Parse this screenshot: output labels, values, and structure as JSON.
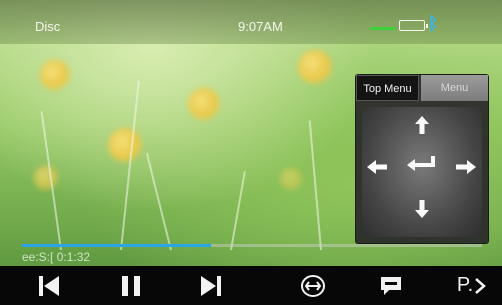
{
  "status_bar": {
    "source": "Disc",
    "time": "9:07AM",
    "icons": [
      "signal-icon",
      "battery-icon",
      "bluetooth-icon"
    ]
  },
  "menu_panel": {
    "tabs": [
      {
        "label": "Top Menu",
        "selected": true
      },
      {
        "label": "Menu",
        "selected": false
      }
    ],
    "dpad": [
      "arrow-up-icon",
      "arrow-left-icon",
      "enter-icon",
      "arrow-right-icon",
      "arrow-down-icon"
    ]
  },
  "playback": {
    "track_info": "ee:S:[ 0:1:32",
    "progress": 0.41
  },
  "controls": {
    "buttons": [
      {
        "name": "previous-track-button",
        "icon": "skip-previous-icon"
      },
      {
        "name": "pause-button",
        "icon": "pause-icon"
      },
      {
        "name": "next-track-button",
        "icon": "skip-next-icon"
      },
      {
        "name": "audio-button",
        "icon": "audio-icon"
      },
      {
        "name": "subtitle-button",
        "icon": "speech-bubble-icon"
      },
      {
        "name": "page-button",
        "icon": "page-next-icon",
        "label": "P."
      }
    ]
  },
  "colors": {
    "accent": "#2aa6e6",
    "signal": "#39d23a",
    "bluetooth": "#33b7f0"
  }
}
